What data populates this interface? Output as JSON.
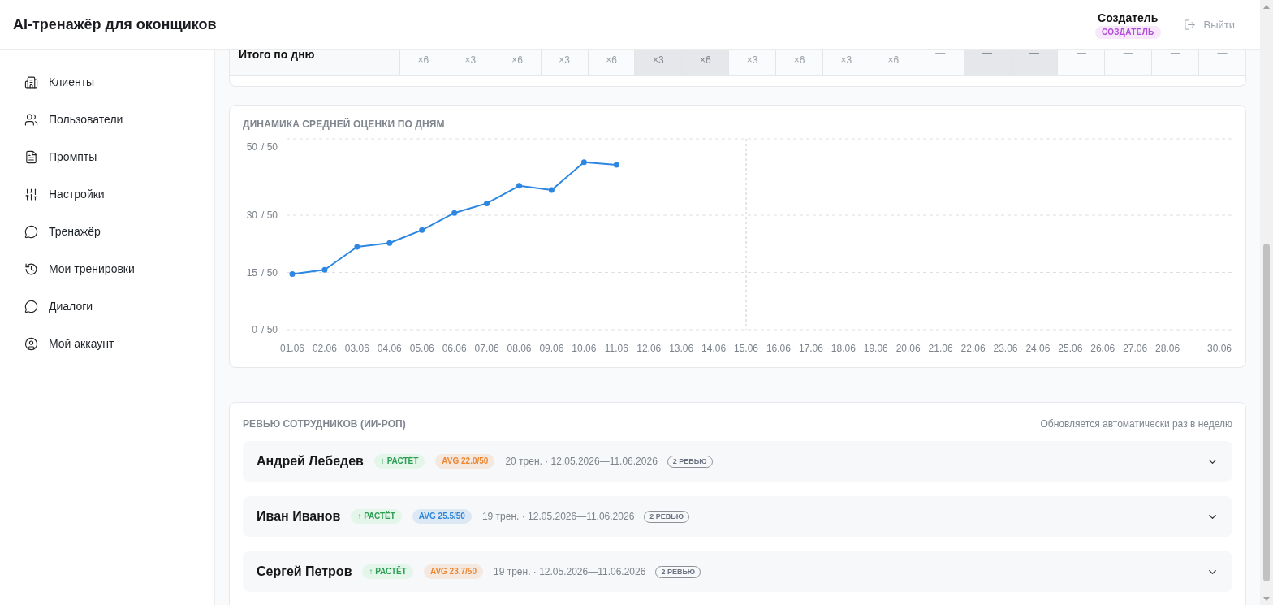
{
  "header": {
    "title": "AI-тренажёр для оконщиков",
    "user": {
      "name": "Создатель",
      "role": "СОЗДАТЕЛЬ"
    },
    "logout": "Выйти"
  },
  "sidebar": {
    "items": [
      {
        "label": "Клиенты",
        "selected": false
      },
      {
        "label": "Пользователи",
        "selected": false
      },
      {
        "label": "Промпты",
        "selected": false
      },
      {
        "label": "Настройки",
        "selected": false
      },
      {
        "label": "Тренажёр",
        "selected": false
      },
      {
        "label": "Мои тренировки",
        "selected": false
      },
      {
        "label": "Диалоги",
        "selected": false
      },
      {
        "label": "Мой аккаунт",
        "selected": false
      }
    ]
  },
  "day_totals": {
    "label": "Итого по дню",
    "cells": [
      {
        "text": "×6",
        "kind": "count",
        "shaded": false
      },
      {
        "text": "×3",
        "kind": "count",
        "shaded": false
      },
      {
        "text": "×6",
        "kind": "count",
        "shaded": false
      },
      {
        "text": "×3",
        "kind": "count",
        "shaded": false
      },
      {
        "text": "×6",
        "kind": "count",
        "shaded": false
      },
      {
        "text": "×3",
        "kind": "count",
        "shaded": true
      },
      {
        "text": "×6",
        "kind": "count",
        "shaded": true
      },
      {
        "text": "×3",
        "kind": "count",
        "shaded": false
      },
      {
        "text": "×6",
        "kind": "count",
        "shaded": false
      },
      {
        "text": "×3",
        "kind": "count",
        "shaded": false
      },
      {
        "text": "×6",
        "kind": "count",
        "shaded": false
      },
      {
        "text": "—",
        "kind": "empty",
        "shaded": false
      },
      {
        "text": "—",
        "kind": "empty",
        "shaded": true
      },
      {
        "text": "—",
        "kind": "empty",
        "shaded": true
      },
      {
        "text": "—",
        "kind": "empty",
        "shaded": false
      },
      {
        "text": "—",
        "kind": "empty",
        "shaded": false
      },
      {
        "text": "—",
        "kind": "empty",
        "shaded": false
      },
      {
        "text": "—",
        "kind": "empty",
        "shaded": false
      }
    ]
  },
  "score_chart": {
    "title": "ДИНАМИКА СРЕДНЕЙ ОЦЕНКИ ПО ДНЯМ",
    "y_tick_suffixes": [
      "/ 50",
      "/ 50",
      "/ 50",
      "/ 50"
    ],
    "chart_data": {
      "type": "line",
      "marker": true,
      "categories": [
        "01.06",
        "02.06",
        "03.06",
        "04.06",
        "05.06",
        "06.06",
        "07.06",
        "08.06",
        "09.06",
        "10.06",
        "11.06",
        "12.06",
        "13.06",
        "14.06",
        "15.06",
        "16.06",
        "17.06",
        "18.06",
        "19.06",
        "20.06",
        "21.06",
        "22.06",
        "23.06",
        "24.06",
        "25.06",
        "26.06",
        "27.06",
        "28.06",
        null,
        "30.06"
      ],
      "values": [
        14.6,
        15.7,
        21.7,
        22.7,
        26.1,
        30.6,
        33.1,
        37.7,
        36.6,
        43.9,
        43.2,
        null,
        null,
        null,
        null,
        null,
        null,
        null,
        null,
        null,
        null,
        null,
        null,
        null,
        null,
        null,
        null,
        null,
        null,
        null
      ],
      "ylim": [
        0,
        50
      ],
      "yticks": [
        0,
        15,
        30,
        50
      ],
      "ref_lines": [
        {
          "axis": "x",
          "value": "15.06"
        }
      ]
    }
  },
  "reviews": {
    "title": "РЕВЬЮ СОТРУДНИКОВ (ИИ-РОП)",
    "note": "Обновляется автоматически раз в неделю",
    "rows": [
      {
        "name": "Андрей Лебедев",
        "trend": {
          "text": "↑ РАСТЁТ",
          "kind": "up"
        },
        "avg": {
          "text": "AVG 22.0/50",
          "color": "#ec8633"
        },
        "meta": "20 трен. · 12.05.2026—11.06.2026",
        "review_count": "2 РЕВЬЮ",
        "expanded": false
      },
      {
        "name": "Иван Иванов",
        "trend": {
          "text": "↑ РАСТЁТ",
          "kind": "up"
        },
        "avg": {
          "text": "AVG 25.5/50",
          "color": "#2f86d8"
        },
        "meta": "19 трен. · 12.05.2026—11.06.2026",
        "review_count": "2 РЕВЬЮ",
        "expanded": false
      },
      {
        "name": "Сергей Петров",
        "trend": {
          "text": "↑ РАСТЁТ",
          "kind": "up"
        },
        "avg": {
          "text": "AVG 23.7/50",
          "color": "#ec8633"
        },
        "meta": "19 трен. · 12.05.2026—11.06.2026",
        "review_count": "2 РЕВЬЮ",
        "expanded": false
      }
    ]
  }
}
